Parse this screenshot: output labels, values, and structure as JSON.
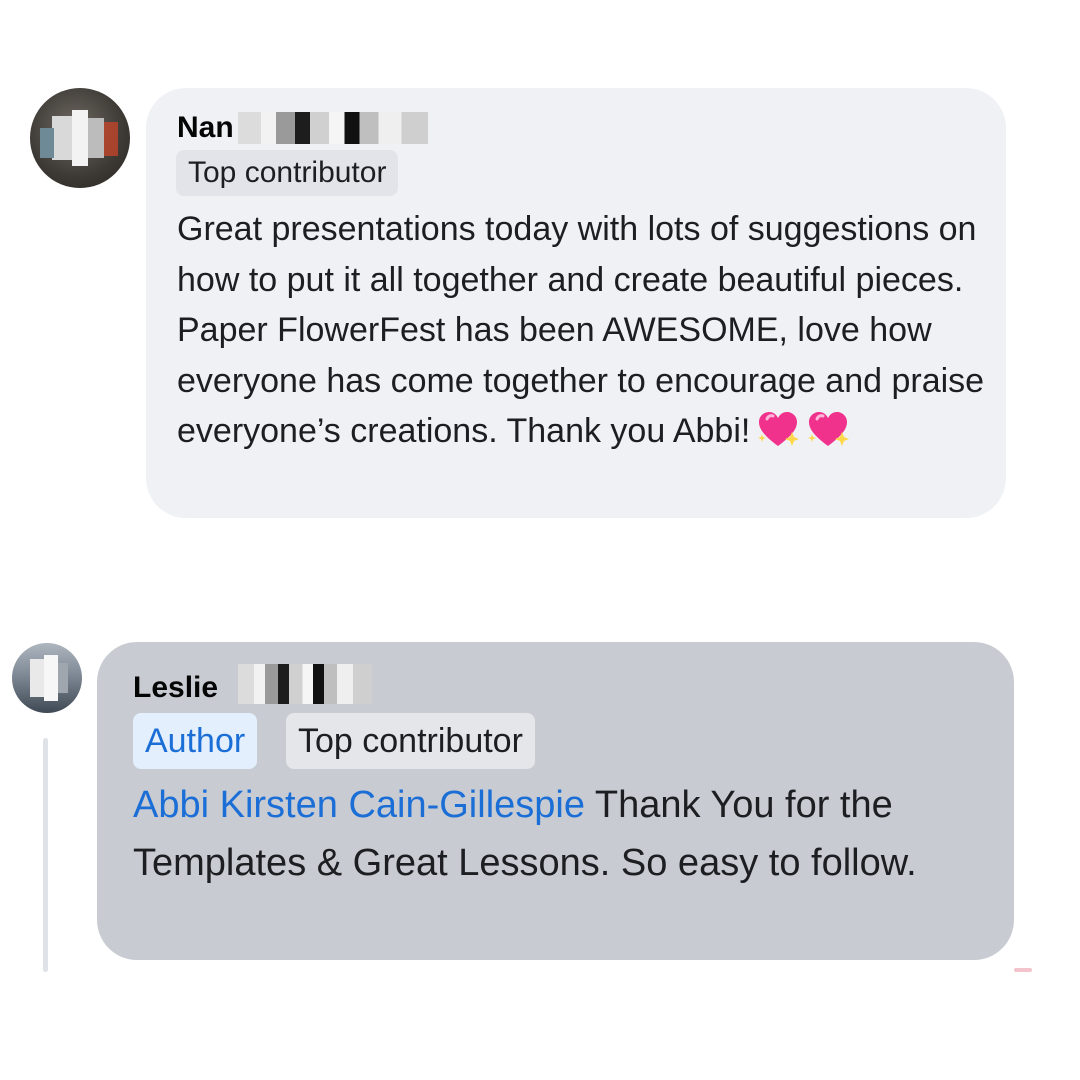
{
  "comments": [
    {
      "author_name": "Nan",
      "badges": [
        "Top contributor"
      ],
      "text": "Great presentations today with lots of suggestions on how to put it all together and create beautiful pieces.  Paper FlowerFest has been AWESOME, love how everyone has come together to encourage and praise everyone’s creations.  Thank you Abbi!",
      "emojis": [
        "sparkling-heart-icon",
        "sparkling-heart-icon"
      ]
    },
    {
      "author_name": "Leslie",
      "badges": [
        "Author",
        "Top contributor"
      ],
      "mention": "Abbi Kirsten Cain-Gillespie",
      "text": " Thank You for the Templates & Great Lessons. So easy to follow."
    }
  ],
  "colors": {
    "bubble_primary": "#eff1f5",
    "bubble_reply": "#c8ccd2",
    "mention_blue": "#1b6ed6",
    "author_badge_bg": "#e3effd",
    "badge_bg": "#e2e4e9"
  }
}
